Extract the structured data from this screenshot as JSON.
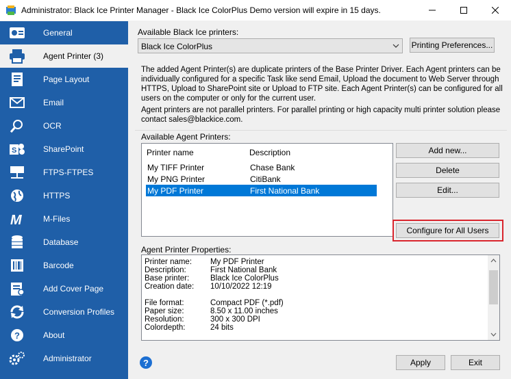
{
  "window": {
    "title": "Administrator: Black Ice Printer Manager - Black Ice ColorPlus Demo version will expire in 15 days."
  },
  "sidebar": {
    "items": [
      {
        "label": "General",
        "icon": "general-icon"
      },
      {
        "label": "Agent Printer (3)",
        "icon": "printer-icon",
        "active": true
      },
      {
        "label": "Page Layout",
        "icon": "page-layout-icon"
      },
      {
        "label": "Email",
        "icon": "email-icon"
      },
      {
        "label": "OCR",
        "icon": "ocr-icon"
      },
      {
        "label": "SharePoint",
        "icon": "sharepoint-icon"
      },
      {
        "label": "FTPS-FTPES",
        "icon": "ftp-icon"
      },
      {
        "label": "HTTPS",
        "icon": "globe-icon"
      },
      {
        "label": "M-Files",
        "icon": "m-files-icon"
      },
      {
        "label": "Database",
        "icon": "database-icon"
      },
      {
        "label": "Barcode",
        "icon": "barcode-icon"
      },
      {
        "label": "Add Cover Page",
        "icon": "cover-page-icon"
      },
      {
        "label": "Conversion Profiles",
        "icon": "conversion-icon"
      },
      {
        "label": "About",
        "icon": "question-icon"
      },
      {
        "label": "Administrator",
        "icon": "gears-icon"
      }
    ]
  },
  "main": {
    "available_printers_label": "Available Black Ice printers:",
    "selected_printer": "Black Ice ColorPlus",
    "printing_prefs_label": "Printing Preferences...",
    "description_1": "The added Agent Printer(s) are duplicate printers of the Base Printer Driver. Each Agent printers can be individually configured for a specific Task like send Email, Upload the document to Web Server through HTTPS, Upload to SharePoint site or Upload to FTP site. Each Agent Printer(s) can be configured for all users on the computer or only for the current user.",
    "description_2": "Agent printers are not parallel printers. For parallel printing or high capacity multi printer solution please contact sales@blackice.com.",
    "agent_printers_label": "Available Agent Printers:",
    "columns": {
      "name": "Printer name",
      "description": "Description"
    },
    "agent_printers": [
      {
        "name": "My TIFF Printer",
        "description": "Chase Bank"
      },
      {
        "name": "My PNG Printer",
        "description": "CitiBank"
      },
      {
        "name": "My PDF Printer",
        "description": "First National Bank",
        "selected": true
      }
    ],
    "buttons": {
      "add_new": "Add new...",
      "delete": "Delete",
      "edit": "Edit...",
      "configure_all": "Configure for All Users",
      "apply": "Apply",
      "exit": "Exit"
    },
    "properties_label": "Agent Printer Properties:",
    "properties": [
      {
        "key": "Printer name:",
        "value": "My PDF Printer"
      },
      {
        "key": "Description:",
        "value": "First National Bank"
      },
      {
        "key": "Base printer:",
        "value": "Black Ice ColorPlus"
      },
      {
        "key": "Creation date:",
        "value": "10/10/2022 12:19"
      },
      {
        "key": "",
        "value": ""
      },
      {
        "key": "File format:",
        "value": "Compact PDF (*.pdf)"
      },
      {
        "key": "Paper size:",
        "value": "8.50 x 11.00 inches"
      },
      {
        "key": "Resolution:",
        "value": "300 x 300 DPI"
      },
      {
        "key": "Colordepth:",
        "value": "24 bits"
      }
    ]
  },
  "colors": {
    "sidebar": "#1f5fa8",
    "selection": "#0078d7",
    "highlight": "#d9242c"
  }
}
